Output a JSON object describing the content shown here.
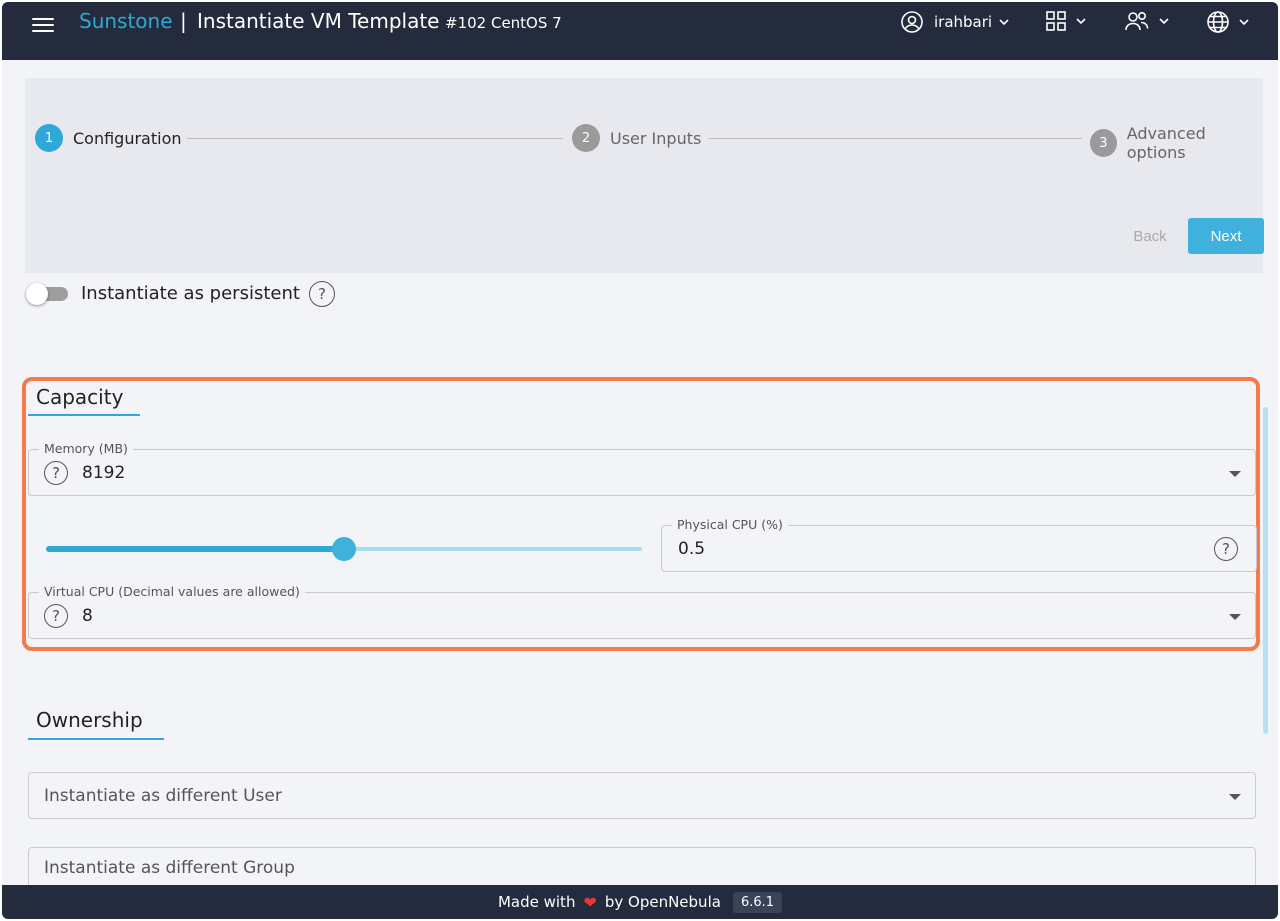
{
  "header": {
    "brand": "Sunstone",
    "separator": "|",
    "title": "Instantiate VM Template",
    "template_id": "#102 CentOS 7",
    "user": "irahbari"
  },
  "stepper": {
    "steps": [
      {
        "number": "1",
        "label": "Configuration"
      },
      {
        "number": "2",
        "label": "User Inputs"
      },
      {
        "number": "3",
        "label": "Advanced options"
      }
    ],
    "back_label": "Back",
    "next_label": "Next"
  },
  "persistent": {
    "label": "Instantiate as persistent",
    "enabled": false
  },
  "capacity": {
    "title": "Capacity",
    "memory": {
      "label": "Memory (MB)",
      "value": "8192"
    },
    "physical_cpu": {
      "label": "Physical CPU (%)",
      "value": "0.5",
      "slider_fraction": 0.5
    },
    "virtual_cpu": {
      "label": "Virtual CPU (Decimal values are allowed)",
      "value": "8"
    }
  },
  "ownership": {
    "title": "Ownership",
    "user_placeholder": "Instantiate as different User",
    "group_placeholder": "Instantiate as different Group"
  },
  "footer": {
    "made_with": "Made with",
    "by": "by OpenNebula",
    "version": "6.6.1"
  },
  "colors": {
    "accent": "#2fa8d8",
    "highlight": "#f57a4a",
    "header_bg": "#242b3c"
  }
}
